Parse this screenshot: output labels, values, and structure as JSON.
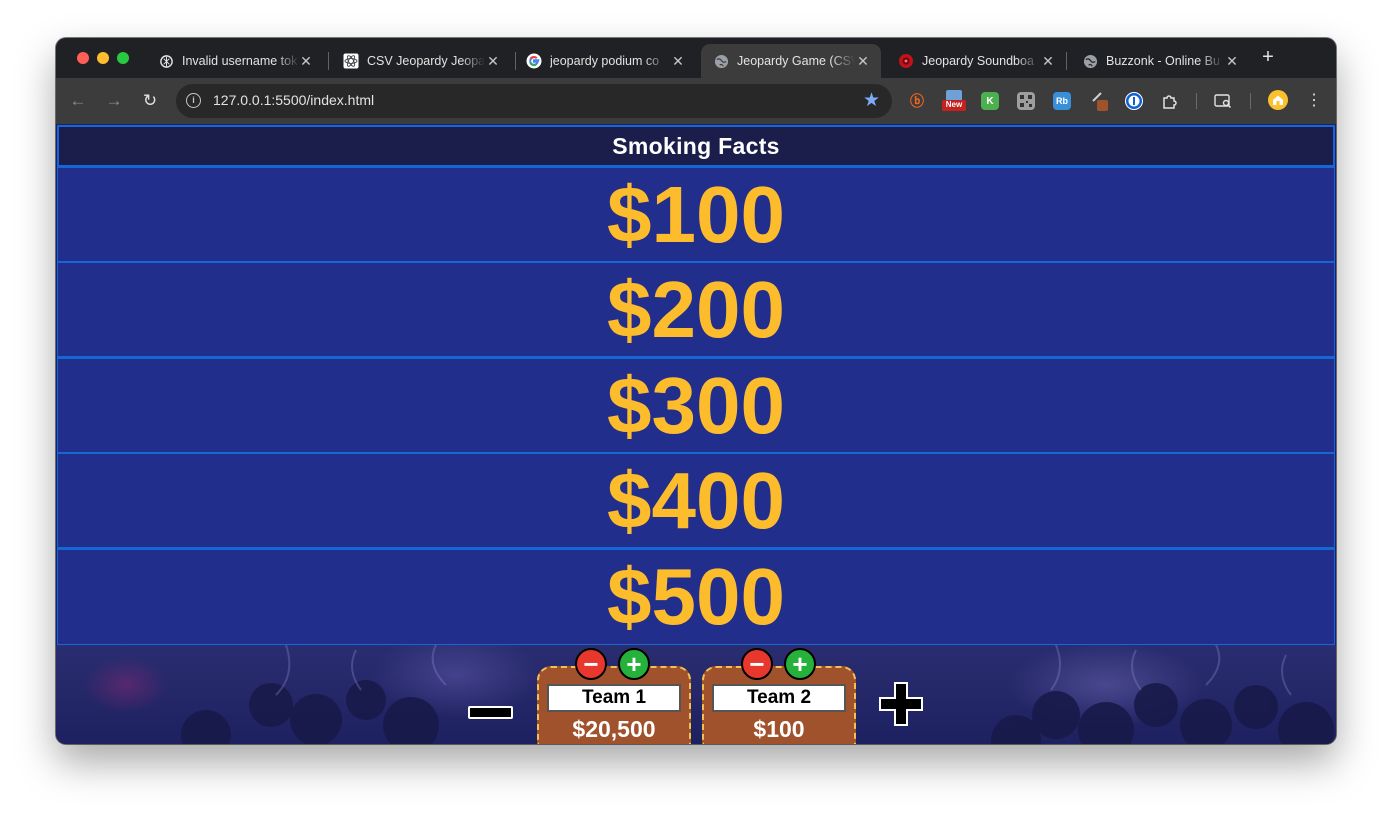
{
  "browser": {
    "tabs": [
      {
        "title": "Invalid username tok",
        "icon": "openai-icon",
        "active": false
      },
      {
        "title": "CSV Jeopardy Jeopardy",
        "icon": "react-icon",
        "active": false
      },
      {
        "title": "jeopardy podium co",
        "icon": "google-icon",
        "active": false
      },
      {
        "title": "Jeopardy Game (CSV",
        "icon": "globe-icon",
        "active": true
      },
      {
        "title": "Jeopardy Soundboa",
        "icon": "soundboard-icon",
        "active": false
      },
      {
        "title": "Buzzonk - Online Bu",
        "icon": "globe-icon",
        "active": false
      }
    ],
    "url": "127.0.0.1:5500/index.html",
    "extensions": [
      "bing-icon",
      "new-badge-extension",
      "k-extension",
      "qr-extension",
      "rb-extension",
      "pen-extension",
      "1password-icon",
      "puzzle-icon",
      "search-tab-icon",
      "profile-avatar"
    ],
    "extension_labels": {
      "new": "New",
      "k": "K",
      "rb": "Rb"
    }
  },
  "board": {
    "category": "Smoking Facts",
    "values": [
      "$100",
      "$200",
      "$300",
      "$400",
      "$500"
    ],
    "value_color": "#fdbc2c",
    "cell_color": "#222e8c",
    "border_color": "#1766d6"
  },
  "teams": [
    {
      "name": "Team 1",
      "score": "$20,500"
    },
    {
      "name": "Team 2",
      "score": "$100"
    }
  ],
  "controls": {
    "minus_symbol": "−",
    "plus_symbol": "+"
  }
}
